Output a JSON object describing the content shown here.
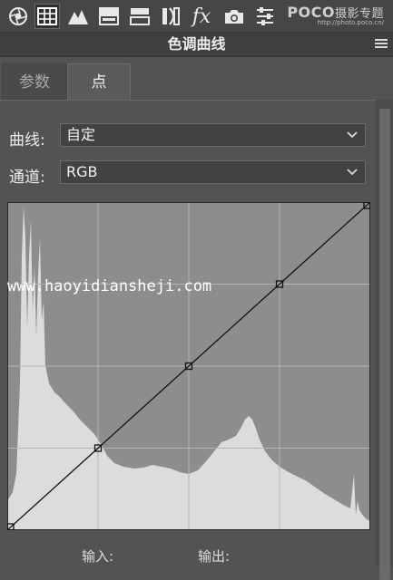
{
  "toolbar": {
    "icons": [
      "aperture-icon",
      "grid-icon",
      "mountain-icon",
      "split-toning-icon",
      "detail-icon",
      "lens-icon",
      "fx-icon",
      "camera-icon",
      "sliders-icon"
    ],
    "fx_label": "fx",
    "watermark": {
      "brand": "POCO",
      "brand_suffix": "摄影专题",
      "url": "http://photo.poco.cn/"
    }
  },
  "panel": {
    "title": "色调曲线"
  },
  "tabs": [
    {
      "label": "参数",
      "active": false
    },
    {
      "label": "点",
      "active": true
    }
  ],
  "curve_select": {
    "label": "曲线:",
    "value": "自定"
  },
  "channel_select": {
    "label": "通道:",
    "value": "RGB"
  },
  "overlay_watermark": "www.haoyidiansheji.com",
  "curve_points": [
    [
      0,
      0
    ],
    [
      25,
      25
    ],
    [
      50,
      50
    ],
    [
      75,
      75
    ],
    [
      100,
      100
    ]
  ],
  "footer": {
    "input_label": "输入:",
    "output_label": "输出:"
  },
  "colors": {
    "background": "#535353",
    "histogram": "#dcdcdc",
    "graph_bg": "#8f8f8f"
  }
}
